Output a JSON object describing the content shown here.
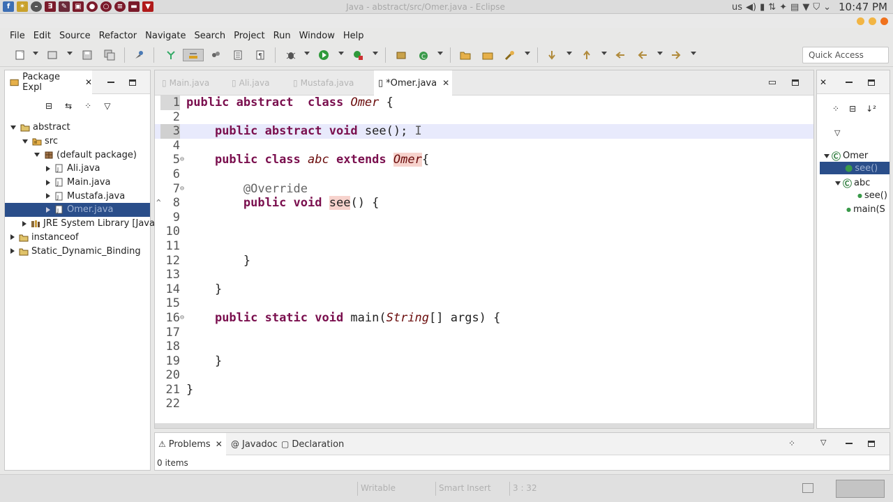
{
  "system_panel": {
    "window_title": "Java - abstract/src/Omer.java - Eclipse",
    "keyboard_layout": "us",
    "clock": "10:47 PM"
  },
  "menu": [
    "File",
    "Edit",
    "Source",
    "Refactor",
    "Navigate",
    "Search",
    "Project",
    "Run",
    "Window",
    "Help"
  ],
  "toolbar": {
    "quick_access_placeholder": "Quick Access"
  },
  "package_explorer": {
    "tab_label": "Package Expl",
    "tree": [
      {
        "label": "abstract",
        "icon": "project-icon",
        "depth": 0,
        "expanded": true
      },
      {
        "label": "src",
        "icon": "source-folder-icon",
        "depth": 1,
        "expanded": true
      },
      {
        "label": "(default package)",
        "icon": "package-icon",
        "depth": 2,
        "expanded": true
      },
      {
        "label": "Ali.java",
        "icon": "java-file-icon",
        "depth": 3,
        "expanded": false
      },
      {
        "label": "Main.java",
        "icon": "java-file-icon",
        "depth": 3,
        "expanded": false
      },
      {
        "label": "Mustafa.java",
        "icon": "java-file-icon",
        "depth": 3,
        "expanded": false
      },
      {
        "label": "Omer.java",
        "icon": "java-file-icon",
        "depth": 3,
        "expanded": false,
        "selected": true
      },
      {
        "label": "JRE System Library [JavaS",
        "icon": "library-icon",
        "depth": 1,
        "expanded": false
      },
      {
        "label": "instanceof",
        "icon": "project-icon",
        "depth": 0,
        "expanded": false
      },
      {
        "label": "Static_Dynamic_Binding",
        "icon": "project-icon",
        "depth": 0,
        "expanded": false
      }
    ]
  },
  "editor": {
    "tabs": [
      {
        "label": "Main.java",
        "active": false
      },
      {
        "label": "Ali.java",
        "active": false
      },
      {
        "label": "Mustafa.java",
        "active": false
      },
      {
        "label": "*Omer.java",
        "active": true
      }
    ],
    "current_line": 3,
    "line_numbers": [
      "1",
      "2",
      "3",
      "4",
      "5",
      "6",
      "7",
      "8",
      "9",
      "10",
      "11",
      "12",
      "13",
      "14",
      "15",
      "16",
      "17",
      "18",
      "19",
      "20",
      "21",
      "22"
    ]
  },
  "outline": {
    "items": [
      {
        "label": "Omer",
        "icon": "abstract-class-icon"
      },
      {
        "label": "see()",
        "icon": "method-icon",
        "selected": true
      },
      {
        "label": "abc",
        "icon": "class-icon"
      },
      {
        "label": "see()",
        "icon": "method-icon"
      },
      {
        "label": "main(S",
        "icon": "method-icon"
      }
    ]
  },
  "problems_panel": {
    "tabs": [
      "Problems",
      "Javadoc",
      "Declaration"
    ],
    "summary": "0 items"
  },
  "status_bar": {
    "writable": "Writable",
    "insert_mode": "Smart Insert",
    "cursor_position": "3 : 32"
  },
  "colors": {
    "keyword": "#7a0f4e",
    "type_ref": "#6a0b0b",
    "current_line_highlight": "#e8eafc",
    "occurrence_highlight": "#f7d3cd",
    "selection": "#2a4e8a"
  }
}
